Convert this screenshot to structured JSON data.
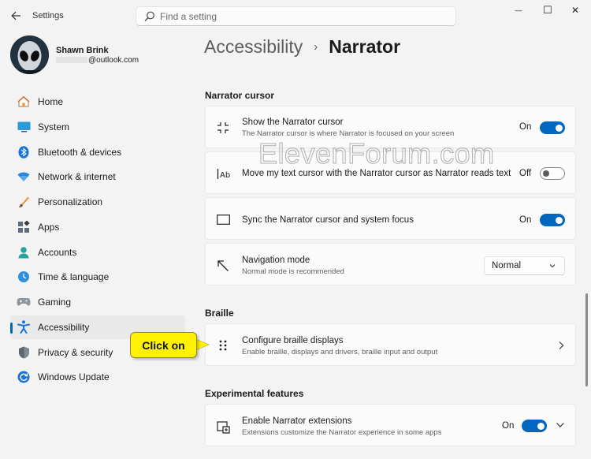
{
  "window": {
    "title": "Settings",
    "minimize_glyph": "—",
    "maximize_glyph": "☐",
    "close_glyph": "✕"
  },
  "search": {
    "placeholder": "Find a setting"
  },
  "profile": {
    "name": "Shawn Brink",
    "email_suffix": "@outlook.com"
  },
  "nav": [
    {
      "label": "Home",
      "icon": "home-icon"
    },
    {
      "label": "System",
      "icon": "system-icon"
    },
    {
      "label": "Bluetooth & devices",
      "icon": "bluetooth-icon"
    },
    {
      "label": "Network & internet",
      "icon": "wifi-icon"
    },
    {
      "label": "Personalization",
      "icon": "brush-icon"
    },
    {
      "label": "Apps",
      "icon": "apps-icon"
    },
    {
      "label": "Accounts",
      "icon": "accounts-icon"
    },
    {
      "label": "Time & language",
      "icon": "time-language-icon"
    },
    {
      "label": "Gaming",
      "icon": "gamepad-icon"
    },
    {
      "label": "Accessibility",
      "icon": "accessibility-icon",
      "active": true
    },
    {
      "label": "Privacy & security",
      "icon": "shield-icon"
    },
    {
      "label": "Windows Update",
      "icon": "update-icon"
    }
  ],
  "breadcrumb": {
    "parent": "Accessibility",
    "separator": "›",
    "current": "Narrator"
  },
  "sections": {
    "cursor": "Narrator cursor",
    "braille": "Braille",
    "experimental": "Experimental features"
  },
  "cards": {
    "show_cursor": {
      "title": "Show the Narrator cursor",
      "subtitle": "The Narrator cursor is where Narrator is focused on your screen",
      "state": "On",
      "icon": "cursor-corners-icon"
    },
    "move_text_cursor": {
      "title": "Move my text cursor with the Narrator cursor as Narrator reads text",
      "state": "Off",
      "icon": "text-cursor-icon"
    },
    "sync_focus": {
      "title": "Sync the Narrator cursor and system focus",
      "state": "On",
      "icon": "rectangle-icon"
    },
    "navigation_mode": {
      "title": "Navigation mode",
      "subtitle": "Normal mode is recommended",
      "value": "Normal",
      "icon": "arrow-up-left-icon"
    },
    "braille_displays": {
      "title": "Configure braille displays",
      "subtitle": "Enable braille, displays and drivers, braille input and output",
      "icon": "braille-icon"
    },
    "extensions": {
      "title": "Enable Narrator extensions",
      "subtitle": "Extensions customize the Narrator experience in some apps",
      "state": "On",
      "icon": "extensions-icon"
    }
  },
  "callout": {
    "text": "Click on"
  },
  "watermark": "ElevenForum.com",
  "colors": {
    "accent": "#0067c0",
    "callout": "#fff200",
    "background": "#f3f3f3",
    "card": "#fbfbfb"
  }
}
